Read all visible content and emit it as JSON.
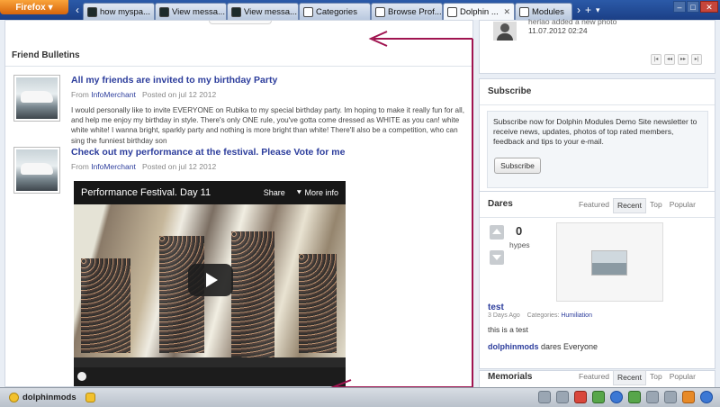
{
  "browser": {
    "app_button": "Firefox",
    "tabs": [
      {
        "label": "how myspa..."
      },
      {
        "label": "View messa..."
      },
      {
        "label": "View messa..."
      },
      {
        "label": "Categories"
      },
      {
        "label": "Browse Prof..."
      },
      {
        "label": "Dolphin ...",
        "active": true
      },
      {
        "label": "Modules"
      }
    ]
  },
  "friend_bulletins": {
    "title": "Friend Bulletins",
    "items": [
      {
        "title": "All my friends are invited to my birthday Party",
        "from": "From",
        "author": "InfoMerchant",
        "posted": "Posted on jul 12 2012",
        "text": "I would personally like to invite EVERYONE on Rubika to my special birthday party. Im hoping to make it really fun for all, and help me enjoy my birthday in style. There's only ONE rule, you've gotta come dressed as WHITE as you can! white white white! I wanna bright, sparkly party and nothing is more bright than white! There'll also be a competition, who can sing the funniest birthday son"
      },
      {
        "title": "Check out my performance at the festival. Please Vote for me",
        "from": "From",
        "author": "InfoMerchant",
        "posted": "Posted on jul 12 2012"
      }
    ],
    "video": {
      "title": "Performance Festival. Day 11",
      "share": "Share",
      "more": "More info"
    }
  },
  "activity": {
    "line": "heriao added a new photo",
    "date": "11.07.2012 02:24"
  },
  "subscribe": {
    "title": "Subscribe",
    "text": "Subscribe now for Dolphin Modules Demo Site newsletter to receive news, updates, photos of top rated members, feedback and tips to your e-mail.",
    "button": "Subscribe"
  },
  "dares": {
    "title": "Dares",
    "tabs": [
      "Featured",
      "Recent",
      "Top",
      "Popular"
    ],
    "active_tab": "Recent",
    "hypes_count": "0",
    "hypes_label": "hypes",
    "item_title": "test",
    "item_age": "3 Days Ago",
    "categories_label": "Categories:",
    "category": "Humiliation",
    "description": "this is a test",
    "user": "dolphinmods",
    "user_suffix": "dares Everyone"
  },
  "memorials": {
    "title": "Memorials",
    "tabs": [
      "Featured",
      "Recent",
      "Top",
      "Popular"
    ]
  },
  "statusbar": {
    "username": "dolphinmods"
  },
  "colors": {
    "link": "#2c3d9c",
    "annotation_arrow": "#a01450",
    "tab_bar": "#2b5aa8"
  }
}
